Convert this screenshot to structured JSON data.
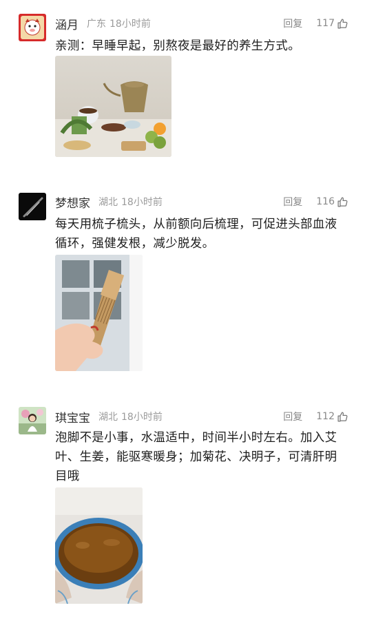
{
  "comments": [
    {
      "username": "涵月",
      "location": "广东",
      "time": "18小时前",
      "reply_label": "回复",
      "likes": "117",
      "text": "亲测：早睡早起，别熬夜是最好的养生方式。",
      "avatar_icon": "red-cartoon-avatar",
      "image_icon": "teapot-still-life-photo"
    },
    {
      "username": "梦想家",
      "location": "湖北",
      "time": "18小时前",
      "reply_label": "回复",
      "likes": "116",
      "text": "每天用梳子梳头，从前额向后梳理，可促进头部血液循环，强健发根，减少脱发。",
      "avatar_icon": "dark-streak-avatar",
      "image_icon": "wooden-comb-photo"
    },
    {
      "username": "琪宝宝",
      "location": "湖北",
      "time": "18小时前",
      "reply_label": "回复",
      "likes": "112",
      "text": "泡脚不是小事，水温适中，时间半小时左右。加入艾叶、生姜，能驱寒暖身；加菊花、决明子，可清肝明目哦",
      "avatar_icon": "child-photo-avatar",
      "image_icon": "foot-bath-photo"
    }
  ],
  "colors": {
    "username": "#333333",
    "meta": "#9a9a9a",
    "body_text": "#1e1e1e"
  }
}
